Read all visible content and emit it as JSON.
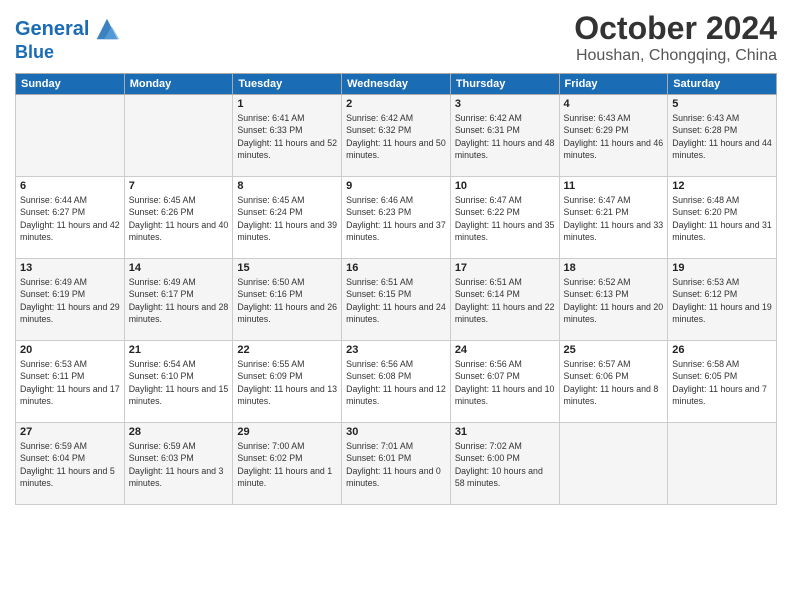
{
  "header": {
    "logo_line1": "General",
    "logo_line2": "Blue",
    "month": "October 2024",
    "location": "Houshan, Chongqing, China"
  },
  "weekdays": [
    "Sunday",
    "Monday",
    "Tuesday",
    "Wednesday",
    "Thursday",
    "Friday",
    "Saturday"
  ],
  "rows": [
    [
      {
        "day": "",
        "info": ""
      },
      {
        "day": "",
        "info": ""
      },
      {
        "day": "1",
        "info": "Sunrise: 6:41 AM\nSunset: 6:33 PM\nDaylight: 11 hours and 52 minutes."
      },
      {
        "day": "2",
        "info": "Sunrise: 6:42 AM\nSunset: 6:32 PM\nDaylight: 11 hours and 50 minutes."
      },
      {
        "day": "3",
        "info": "Sunrise: 6:42 AM\nSunset: 6:31 PM\nDaylight: 11 hours and 48 minutes."
      },
      {
        "day": "4",
        "info": "Sunrise: 6:43 AM\nSunset: 6:29 PM\nDaylight: 11 hours and 46 minutes."
      },
      {
        "day": "5",
        "info": "Sunrise: 6:43 AM\nSunset: 6:28 PM\nDaylight: 11 hours and 44 minutes."
      }
    ],
    [
      {
        "day": "6",
        "info": "Sunrise: 6:44 AM\nSunset: 6:27 PM\nDaylight: 11 hours and 42 minutes."
      },
      {
        "day": "7",
        "info": "Sunrise: 6:45 AM\nSunset: 6:26 PM\nDaylight: 11 hours and 40 minutes."
      },
      {
        "day": "8",
        "info": "Sunrise: 6:45 AM\nSunset: 6:24 PM\nDaylight: 11 hours and 39 minutes."
      },
      {
        "day": "9",
        "info": "Sunrise: 6:46 AM\nSunset: 6:23 PM\nDaylight: 11 hours and 37 minutes."
      },
      {
        "day": "10",
        "info": "Sunrise: 6:47 AM\nSunset: 6:22 PM\nDaylight: 11 hours and 35 minutes."
      },
      {
        "day": "11",
        "info": "Sunrise: 6:47 AM\nSunset: 6:21 PM\nDaylight: 11 hours and 33 minutes."
      },
      {
        "day": "12",
        "info": "Sunrise: 6:48 AM\nSunset: 6:20 PM\nDaylight: 11 hours and 31 minutes."
      }
    ],
    [
      {
        "day": "13",
        "info": "Sunrise: 6:49 AM\nSunset: 6:19 PM\nDaylight: 11 hours and 29 minutes."
      },
      {
        "day": "14",
        "info": "Sunrise: 6:49 AM\nSunset: 6:17 PM\nDaylight: 11 hours and 28 minutes."
      },
      {
        "day": "15",
        "info": "Sunrise: 6:50 AM\nSunset: 6:16 PM\nDaylight: 11 hours and 26 minutes."
      },
      {
        "day": "16",
        "info": "Sunrise: 6:51 AM\nSunset: 6:15 PM\nDaylight: 11 hours and 24 minutes."
      },
      {
        "day": "17",
        "info": "Sunrise: 6:51 AM\nSunset: 6:14 PM\nDaylight: 11 hours and 22 minutes."
      },
      {
        "day": "18",
        "info": "Sunrise: 6:52 AM\nSunset: 6:13 PM\nDaylight: 11 hours and 20 minutes."
      },
      {
        "day": "19",
        "info": "Sunrise: 6:53 AM\nSunset: 6:12 PM\nDaylight: 11 hours and 19 minutes."
      }
    ],
    [
      {
        "day": "20",
        "info": "Sunrise: 6:53 AM\nSunset: 6:11 PM\nDaylight: 11 hours and 17 minutes."
      },
      {
        "day": "21",
        "info": "Sunrise: 6:54 AM\nSunset: 6:10 PM\nDaylight: 11 hours and 15 minutes."
      },
      {
        "day": "22",
        "info": "Sunrise: 6:55 AM\nSunset: 6:09 PM\nDaylight: 11 hours and 13 minutes."
      },
      {
        "day": "23",
        "info": "Sunrise: 6:56 AM\nSunset: 6:08 PM\nDaylight: 11 hours and 12 minutes."
      },
      {
        "day": "24",
        "info": "Sunrise: 6:56 AM\nSunset: 6:07 PM\nDaylight: 11 hours and 10 minutes."
      },
      {
        "day": "25",
        "info": "Sunrise: 6:57 AM\nSunset: 6:06 PM\nDaylight: 11 hours and 8 minutes."
      },
      {
        "day": "26",
        "info": "Sunrise: 6:58 AM\nSunset: 6:05 PM\nDaylight: 11 hours and 7 minutes."
      }
    ],
    [
      {
        "day": "27",
        "info": "Sunrise: 6:59 AM\nSunset: 6:04 PM\nDaylight: 11 hours and 5 minutes."
      },
      {
        "day": "28",
        "info": "Sunrise: 6:59 AM\nSunset: 6:03 PM\nDaylight: 11 hours and 3 minutes."
      },
      {
        "day": "29",
        "info": "Sunrise: 7:00 AM\nSunset: 6:02 PM\nDaylight: 11 hours and 1 minute."
      },
      {
        "day": "30",
        "info": "Sunrise: 7:01 AM\nSunset: 6:01 PM\nDaylight: 11 hours and 0 minutes."
      },
      {
        "day": "31",
        "info": "Sunrise: 7:02 AM\nSunset: 6:00 PM\nDaylight: 10 hours and 58 minutes."
      },
      {
        "day": "",
        "info": ""
      },
      {
        "day": "",
        "info": ""
      }
    ]
  ]
}
